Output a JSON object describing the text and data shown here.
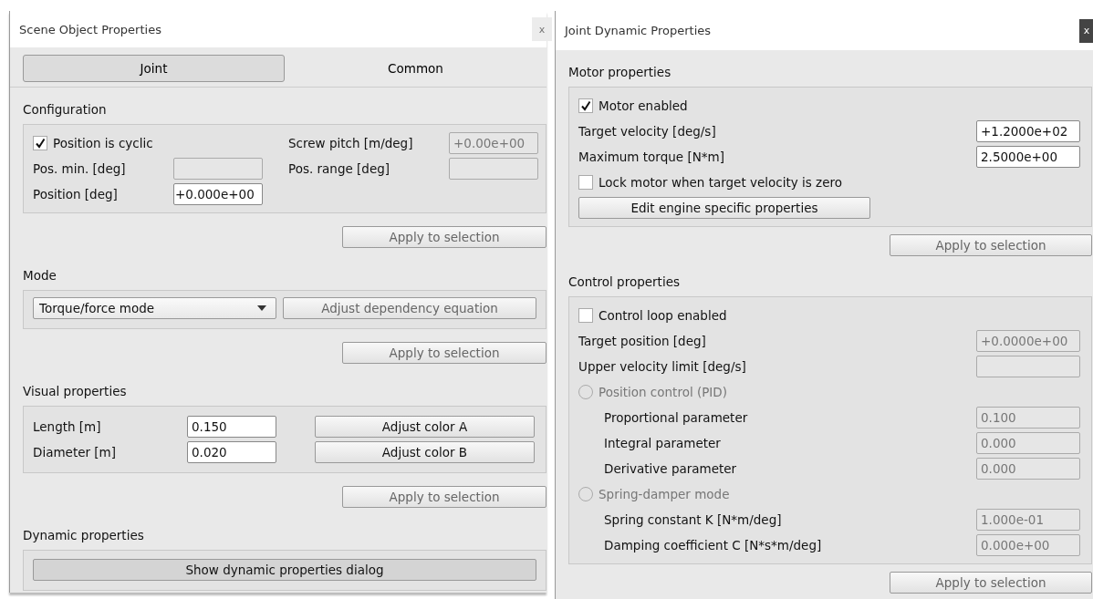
{
  "scene_window": {
    "title": "Scene Object Properties",
    "close": "x",
    "tabs": [
      {
        "label": "Joint",
        "selected": true
      },
      {
        "label": "Common",
        "selected": false
      }
    ],
    "configuration": {
      "heading": "Configuration",
      "cyclic": {
        "label": "Position is cyclic",
        "checked": true
      },
      "screw_pitch": {
        "label": "Screw pitch [m/deg]",
        "value": "+0.00e+00",
        "disabled": true
      },
      "pos_min": {
        "label": "Pos. min. [deg]",
        "disabled": true
      },
      "pos_range": {
        "label": "Pos. range [deg]",
        "disabled": true
      },
      "position": {
        "label": "Position [deg]",
        "value": "+0.000e+00",
        "disabled": false
      },
      "apply": {
        "label": "Apply to selection",
        "disabled": true
      }
    },
    "mode": {
      "heading": "Mode",
      "combo": "Torque/force mode",
      "button": {
        "label": "Adjust dependency equation",
        "disabled": true
      },
      "apply": {
        "label": "Apply to selection",
        "disabled": true
      }
    },
    "visual": {
      "heading": "Visual properties",
      "rows": [
        {
          "label": "Length [m]",
          "value": "0.150",
          "button": "Adjust color A"
        },
        {
          "label": "Diameter [m]",
          "value": "0.020",
          "button": "Adjust color B"
        }
      ],
      "apply": {
        "label": "Apply to selection",
        "disabled": true
      }
    },
    "dynamic": {
      "heading": "Dynamic properties",
      "button": "Show dynamic properties dialog"
    }
  },
  "dynamic_window": {
    "title": "Joint Dynamic Properties",
    "close": "x",
    "sections": [
      {
        "heading": "Motor properties",
        "items": [
          {
            "kind": "check",
            "label": "Motor enabled",
            "checked": true
          },
          {
            "kind": "field",
            "label": "Target velocity [deg/s]",
            "value": "+1.2000e+02",
            "disabled": false
          },
          {
            "kind": "field",
            "label": "Maximum torque [N*m]",
            "value": "2.5000e+00",
            "disabled": false
          },
          {
            "kind": "check",
            "label": "Lock motor when target velocity is zero",
            "checked": false
          },
          {
            "kind": "button",
            "label": "Edit engine specific properties"
          }
        ],
        "apply": {
          "label": "Apply to selection",
          "disabled": true
        }
      },
      {
        "heading": "Control properties",
        "items": [
          {
            "kind": "check",
            "label": "Control loop enabled",
            "checked": false
          },
          {
            "kind": "field",
            "label": "Target position [deg]",
            "value": "+0.0000e+00",
            "disabled": true
          },
          {
            "kind": "field",
            "label": "Upper velocity limit [deg/s]",
            "disabled": true
          },
          {
            "kind": "radio",
            "label": "Position control (PID)",
            "selected": false,
            "disabled": true,
            "children": [
              {
                "kind": "field",
                "label": "Proportional parameter",
                "value": "0.100",
                "disabled": true
              },
              {
                "kind": "field",
                "label": "Integral parameter",
                "value": "0.000",
                "disabled": true
              },
              {
                "kind": "field",
                "label": "Derivative parameter",
                "value": "0.000",
                "disabled": true
              }
            ]
          },
          {
            "kind": "radio",
            "label": "Spring-damper mode",
            "selected": false,
            "disabled": true,
            "children": [
              {
                "kind": "field",
                "label": "Spring constant K [N*m/deg]",
                "value": "1.000e-01",
                "disabled": true
              },
              {
                "kind": "field",
                "label": "Damping coefficient C [N*s*m/deg]",
                "value": "0.000e+00",
                "disabled": true
              }
            ]
          }
        ],
        "apply": {
          "label": "Apply to selection",
          "disabled": true
        }
      }
    ]
  }
}
